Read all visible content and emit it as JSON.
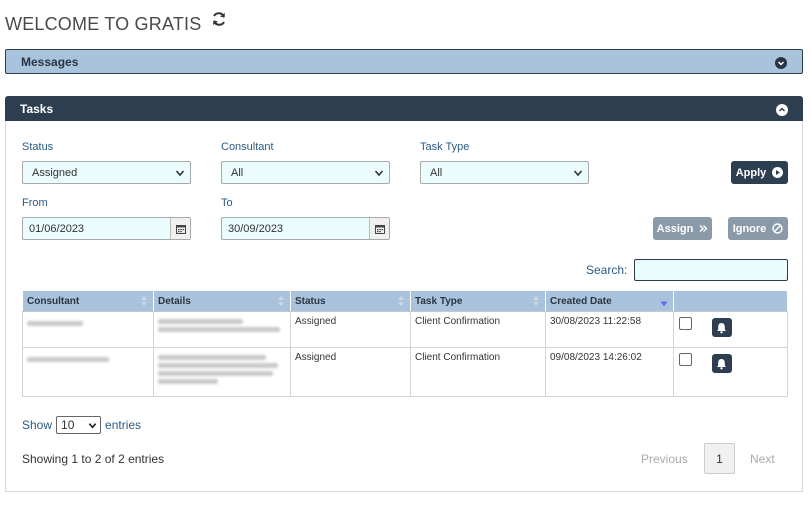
{
  "header": {
    "title": "WELCOME TO GRATIS",
    "refresh_icon": "refresh-icon"
  },
  "messages_panel": {
    "title": "Messages",
    "toggle_icon": "chevron-down-circle-icon"
  },
  "tasks_panel": {
    "title": "Tasks",
    "toggle_icon": "chevron-up-circle-icon",
    "filters": {
      "status_label": "Status",
      "status_value": "Assigned",
      "consultant_label": "Consultant",
      "consultant_value": "All",
      "task_type_label": "Task Type",
      "task_type_value": "All",
      "from_label": "From",
      "from_value": "01/06/2023",
      "to_label": "To",
      "to_value": "30/09/2023"
    },
    "buttons": {
      "apply": "Apply",
      "assign": "Assign",
      "ignore": "Ignore"
    },
    "search_label": "Search:",
    "search_value": "",
    "table": {
      "headers": [
        "Consultant",
        "Details",
        "Status",
        "Task Type",
        "Created Date",
        ""
      ],
      "rows": [
        {
          "status": "Assigned",
          "task_type": "Client Confirmation",
          "created": "30/08/2023 11:22:58"
        },
        {
          "status": "Assigned",
          "task_type": "Client Confirmation",
          "created": "09/08/2023 14:26:02"
        }
      ]
    },
    "length": {
      "show": "Show",
      "value": "10",
      "entries": "entries"
    },
    "info": "Showing 1 to 2 of 2 entries",
    "pagination": {
      "previous": "Previous",
      "page": "1",
      "next": "Next"
    }
  },
  "colors": {
    "dark_header": "#2c3e50",
    "light_header": "#a9c3dc",
    "input_bg": "#eafcfd"
  }
}
